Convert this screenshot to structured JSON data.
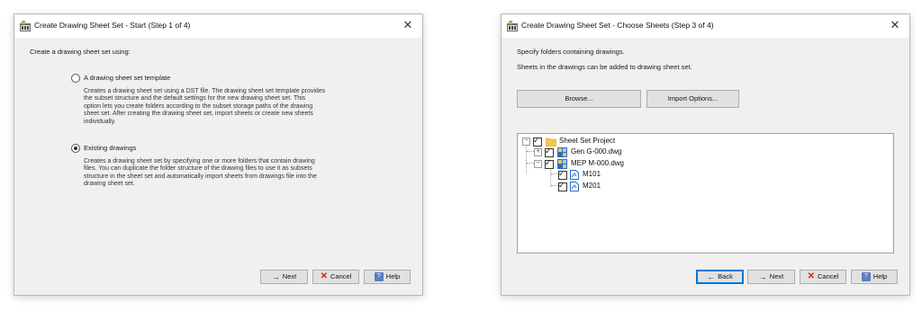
{
  "dialog1": {
    "title": "Create Drawing Sheet Set - Start (Step 1 of 4)",
    "prompt": "Create a drawing sheet set using:",
    "options": [
      {
        "label": "A drawing sheet set template",
        "selected": false,
        "description_lines": [
          "Creates a drawing sheet set using a DST file. The drawing sheet set template provides",
          "the subset structure and the default settings for the new drawing sheet set. This",
          "option lets you create folders according to the subset storage paths of the drawing",
          "sheet set. After creating the drawing sheet set, import sheets or create new sheets",
          "individually."
        ]
      },
      {
        "label": "Existing drawings",
        "selected": true,
        "description_lines": [
          "Creates a drawing sheet set by specifying one or more folders that contain drawing",
          "files. You can duplicate the folder structure of the drawing files to use it as subsets",
          "structure in the sheet set and automatically import sheets from drawings file into the",
          "drawing sheet set."
        ]
      }
    ],
    "buttons": {
      "next": "Next",
      "cancel": "Cancel",
      "help": "Help"
    }
  },
  "dialog2": {
    "title": "Create Drawing Sheet Set - Choose Sheets (Step 3 of 4)",
    "instructions": [
      "Specify folders containing drawings.",
      "Sheets in the drawings can be added to drawing sheet set."
    ],
    "browse_label": "Browse...",
    "import_options_label": "Import Options...",
    "tree": {
      "root": {
        "label": "Sheet Set Project",
        "checked": true,
        "expander": "−"
      },
      "files": [
        {
          "label": "Gen G-000.dwg",
          "checked": true,
          "expander": "+"
        },
        {
          "label": "MEP M-000.dwg",
          "checked": true,
          "expander": "−",
          "sheets": [
            {
              "label": "M101",
              "checked": true
            },
            {
              "label": "M201",
              "checked": true
            }
          ]
        }
      ]
    },
    "buttons": {
      "back": "Back",
      "next": "Next",
      "cancel": "Cancel",
      "help": "Help"
    }
  },
  "glyphs": {
    "close": "✕",
    "arrow_right": "→",
    "arrow_left": "←",
    "cancel_x": "✕",
    "help": "?",
    "check": "✓"
  },
  "colors": {
    "dialog_bg": "#f0f0f0",
    "titlebar_bg": "#ffffff",
    "primary_border": "#0078d7",
    "cancel_red": "#d81e1e",
    "folder_yellow": "#f5c84c"
  }
}
